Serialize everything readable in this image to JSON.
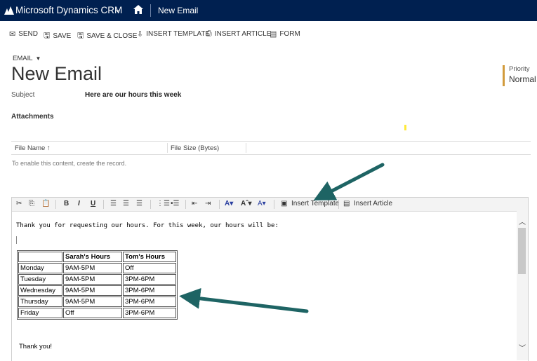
{
  "topbar": {
    "app_name": "Microsoft Dynamics CRM",
    "chevron": "⌄",
    "breadcrumb": "New Email"
  },
  "commands": [
    {
      "label": "SEND",
      "icon": "send-icon",
      "glyph": "✉"
    },
    {
      "label": "SAVE",
      "icon": "save-icon",
      "glyph": "🖫"
    },
    {
      "label": "SAVE & CLOSE",
      "icon": "save-close-icon",
      "glyph": "🖫"
    },
    {
      "label": "INSERT TEMPLATE",
      "icon": "insert-template-icon",
      "glyph": "⇩"
    },
    {
      "label": "INSERT ARTICLE",
      "icon": "insert-article-icon",
      "glyph": "⎙"
    },
    {
      "label": "FORM",
      "icon": "form-icon",
      "glyph": "▤"
    }
  ],
  "form": {
    "type_label": "EMAIL",
    "title": "New Email",
    "priority_label": "Priority",
    "priority_value": "Normal",
    "subject_label": "Subject",
    "subject_value": "Here are our hours this week",
    "attachments_label": "Attachments",
    "grid_columns": [
      "File Name ↑",
      "File Size (Bytes)"
    ],
    "grid_empty": "To enable this content, create the record."
  },
  "editor_toolbar": {
    "bold": "B",
    "italic": "I",
    "underline": "U",
    "insert_template": "Insert Template",
    "insert_article": "Insert Article"
  },
  "editor_body": {
    "intro": "Thank you for requesting our hours. For this week, our hours will be:",
    "table_header": [
      "",
      "Sarah's Hours",
      "Tom's Hours"
    ],
    "table_rows": [
      [
        "Monday",
        "9AM-5PM",
        "Off"
      ],
      [
        "Tuesday",
        "9AM-5PM",
        "3PM-6PM"
      ],
      [
        "Wednesday",
        "9AM-5PM",
        "3PM-6PM"
      ],
      [
        "Thursday",
        "9AM-5PM",
        "3PM-6PM"
      ],
      [
        "Friday",
        "Off",
        "3PM-6PM"
      ]
    ],
    "closing": "Thank you!"
  },
  "colors": {
    "topbar": "#002050",
    "annotation_arrow": "#1e6464",
    "priority_accent": "#d29b3c"
  }
}
